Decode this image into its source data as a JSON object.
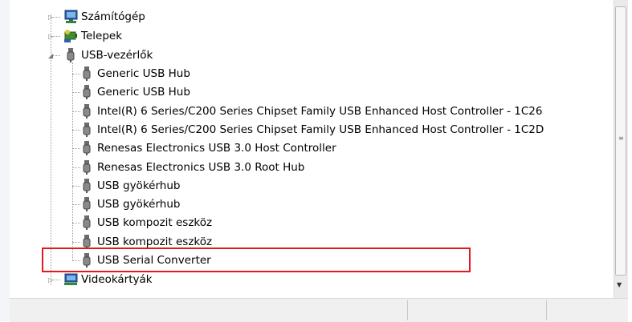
{
  "tree": {
    "computers": {
      "label": "Számítógép",
      "icon": "computer-icon"
    },
    "batteries": {
      "label": "Telepek",
      "icon": "battery-icon"
    },
    "usb_controllers": {
      "label": "USB-vezérlők",
      "icon": "usb-plug-icon",
      "items": [
        "Generic USB Hub",
        "Generic USB Hub",
        "Intel(R) 6 Series/C200 Series Chipset Family USB Enhanced Host Controller - 1C26",
        "Intel(R) 6 Series/C200 Series Chipset Family USB Enhanced Host Controller - 1C2D",
        "Renesas Electronics USB 3.0 Host Controller",
        "Renesas Electronics USB 3.0 Root Hub",
        "USB gyökérhub",
        "USB gyökérhub",
        "USB kompozit eszköz",
        "USB kompozit eszköz",
        "USB Serial Converter"
      ]
    },
    "display_adapters": {
      "label": "Videokártyák",
      "icon": "display-adapter-icon"
    }
  },
  "colors": {
    "highlight_border": "#e2191f",
    "tree_line": "#9a9a9a"
  }
}
